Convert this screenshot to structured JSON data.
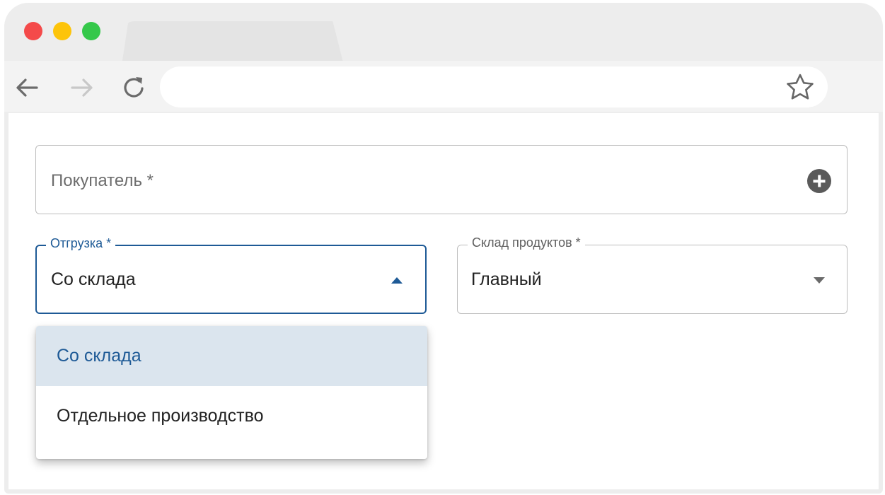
{
  "browser": {
    "address_value": ""
  },
  "form": {
    "buyer": {
      "placeholder": "Покупатель *",
      "add_icon": "plus-circle-icon"
    },
    "shipping": {
      "label": "Отгрузка *",
      "value": "Со склада",
      "options": [
        "Со склада",
        "Отдельное производство"
      ],
      "selected_index": 0
    },
    "warehouse": {
      "label": "Склад продуктов *",
      "value": "Главный"
    }
  },
  "colors": {
    "accent": "#1e5a96",
    "selected_bg": "#dbe5ee"
  }
}
